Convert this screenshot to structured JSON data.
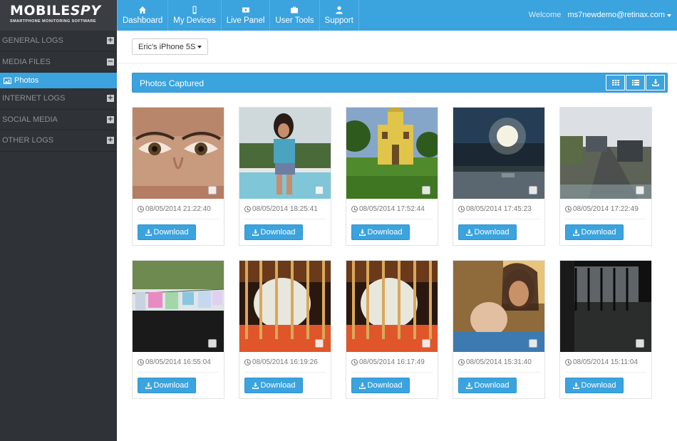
{
  "brand": {
    "name_left": "MOBILE",
    "name_right": "SPY",
    "tagline": "SMARTPHONE MONITORING SOFTWARE"
  },
  "nav": [
    {
      "label": "Dashboard",
      "icon": "home-icon"
    },
    {
      "label": "My Devices",
      "icon": "phone-icon"
    },
    {
      "label": "Live Panel",
      "icon": "play-icon"
    },
    {
      "label": "User Tools",
      "icon": "briefcase-icon"
    },
    {
      "label": "Support",
      "icon": "user-icon"
    }
  ],
  "header": {
    "welcome": "Welcome",
    "user": "ms7newdemo@retinax.com"
  },
  "sidebar": {
    "items": [
      {
        "label": "GENERAL LOGS",
        "toggle": "+"
      },
      {
        "label": "MEDIA FILES",
        "toggle": "−"
      },
      {
        "label": "INTERNET LOGS",
        "toggle": "+"
      },
      {
        "label": "SOCIAL MEDIA",
        "toggle": "+"
      },
      {
        "label": "OTHER LOGS",
        "toggle": "+"
      }
    ],
    "active_sub": "Photos"
  },
  "device": {
    "selected": "Eric's iPhone 5S"
  },
  "panel": {
    "title": "Photos Captured"
  },
  "download_label": "Download",
  "photos": [
    {
      "timestamp": "08/05/2014 21:22:40",
      "subject": "eyes"
    },
    {
      "timestamp": "08/05/2014 18:25:41",
      "subject": "girl-by-pool"
    },
    {
      "timestamp": "08/05/2014 17:52:44",
      "subject": "yellow-church"
    },
    {
      "timestamp": "08/05/2014 17:45:23",
      "subject": "sun-over-water"
    },
    {
      "timestamp": "08/05/2014 17:22:49",
      "subject": "road"
    },
    {
      "timestamp": "08/05/2014 16:55:04",
      "subject": "clothesline"
    },
    {
      "timestamp": "08/05/2014 16:19:26",
      "subject": "crib-toy"
    },
    {
      "timestamp": "08/05/2014 16:17:49",
      "subject": "crib-toy"
    },
    {
      "timestamp": "08/05/2014 15:31:40",
      "subject": "mother-baby"
    },
    {
      "timestamp": "08/05/2014 15:11:04",
      "subject": "dark-yard"
    }
  ]
}
